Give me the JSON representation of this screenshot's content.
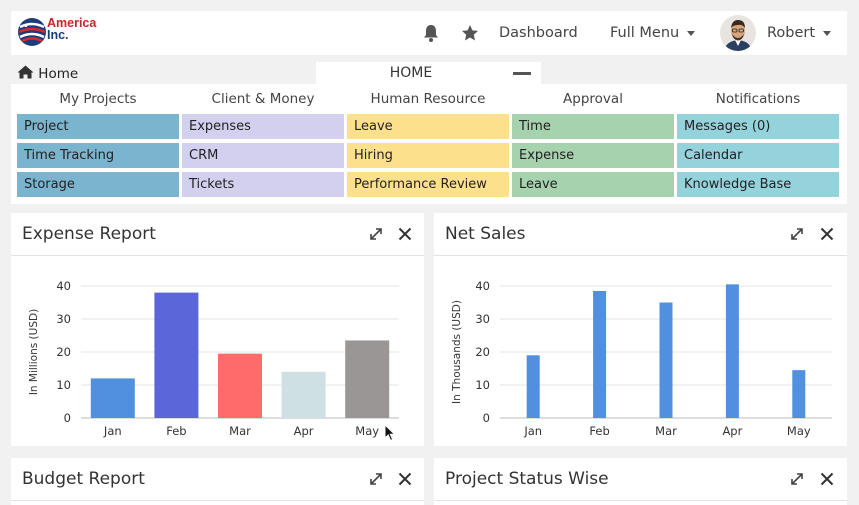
{
  "header": {
    "logo_line1": "America",
    "logo_line2": "Inc.",
    "dashboard_label": "Dashboard",
    "full_menu_label": "Full Menu",
    "user_name": "Robert"
  },
  "breadcrumb": {
    "home_label": "Home"
  },
  "home_tab": {
    "label": "HOME"
  },
  "menu": {
    "columns": [
      {
        "title": "My Projects",
        "color": "#7bb4cf",
        "items": [
          "Project",
          "Time Tracking",
          "Storage"
        ]
      },
      {
        "title": "Client & Money",
        "color": "#d3d0ef",
        "items": [
          "Expenses",
          "CRM",
          "Tickets"
        ]
      },
      {
        "title": "Human Resource",
        "color": "#fde08b",
        "items": [
          "Leave",
          "Hiring",
          "Performance Review"
        ]
      },
      {
        "title": "Approval",
        "color": "#a6d2ad",
        "items": [
          "Time",
          "Expense",
          "Leave"
        ]
      },
      {
        "title": "Notifications",
        "color": "#94d2dc",
        "items": [
          "Messages (0)",
          "Calendar",
          "Knowledge Base"
        ]
      }
    ]
  },
  "widgets": {
    "expense_report": {
      "title": "Expense Report"
    },
    "net_sales": {
      "title": "Net Sales"
    },
    "budget_report": {
      "title": "Budget Report"
    },
    "project_status": {
      "title": "Project Status Wise"
    }
  },
  "chart_data": [
    {
      "type": "bar",
      "categories": [
        "Jan",
        "Feb",
        "Mar",
        "Apr",
        "May"
      ],
      "values": [
        12,
        38,
        19.5,
        14,
        23.5
      ],
      "colors": [
        "#5090de",
        "#5b67d8",
        "#ff6b6b",
        "#cfe0e4",
        "#9a9696"
      ],
      "ylabel": "In Millions (USD)",
      "ylim": [
        0,
        40
      ],
      "yticks": [
        0,
        10,
        20,
        30,
        40
      ],
      "grid": true
    },
    {
      "type": "bar",
      "categories": [
        "Jan",
        "Feb",
        "Mar",
        "Apr",
        "May"
      ],
      "values": [
        19,
        38.5,
        35,
        40.5,
        14.5
      ],
      "colors": [
        "#5090de",
        "#5090de",
        "#5090de",
        "#5090de",
        "#5090de"
      ],
      "ylabel": "In Thousands (USD)",
      "ylim": [
        0,
        40
      ],
      "yticks": [
        0,
        10,
        20,
        30,
        40
      ],
      "grid": true
    }
  ]
}
